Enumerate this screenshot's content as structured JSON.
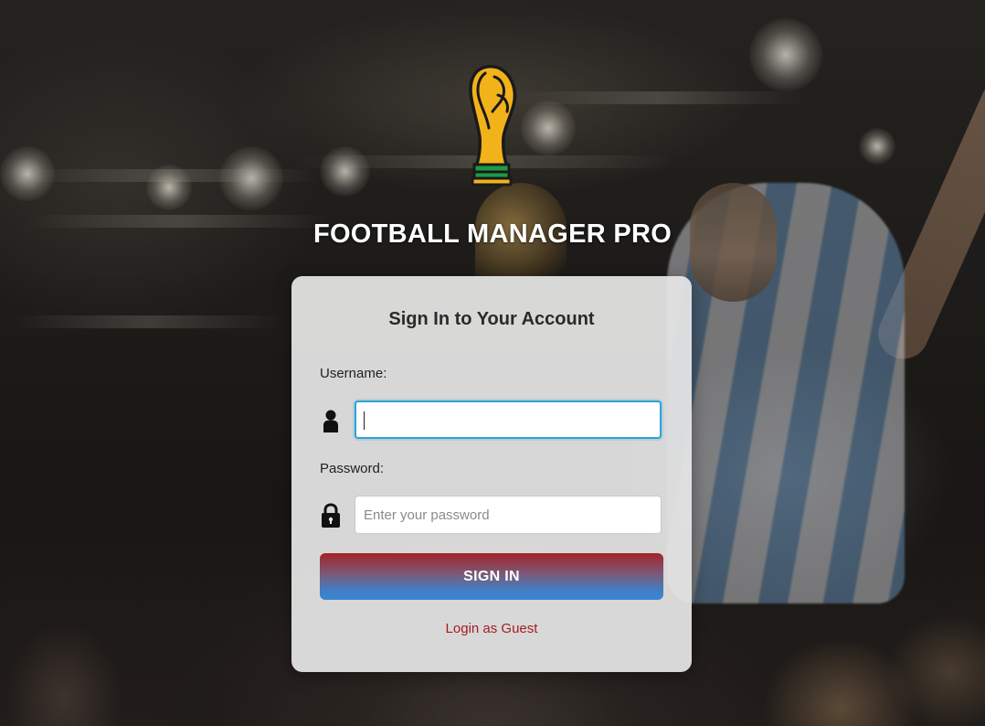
{
  "app": {
    "title": "FOOTBALL MANAGER PRO",
    "logo_icon": "world-cup-trophy-icon"
  },
  "login": {
    "heading": "Sign In to Your Account",
    "username": {
      "label": "Username:",
      "value": "",
      "placeholder": "",
      "icon": "user-icon"
    },
    "password": {
      "label": "Password:",
      "value": "",
      "placeholder": "Enter your password",
      "icon": "lock-icon"
    },
    "signin_label": "SIGN IN",
    "guest_label": "Login as Guest"
  },
  "colors": {
    "button_top": "#a3242b",
    "button_bottom": "#3b86d4",
    "guest_link": "#a51d22",
    "focus_border": "#2ba3d8",
    "trophy_gold": "#f2b21a",
    "trophy_green": "#1f9a45"
  }
}
